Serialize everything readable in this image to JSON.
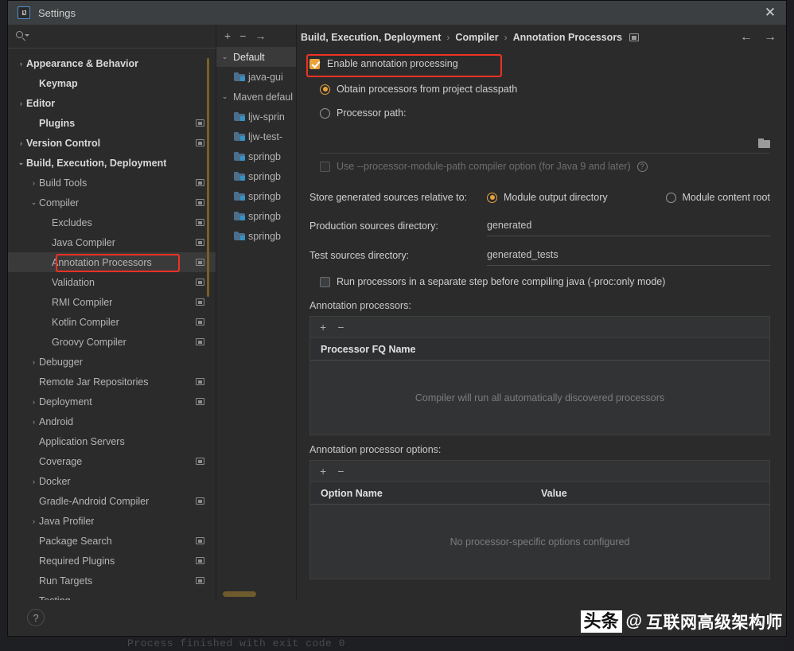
{
  "window": {
    "title": "Settings",
    "logo_text": "IJ",
    "close_label": "✕"
  },
  "search": {
    "value": "",
    "placeholder": ""
  },
  "sidebar": {
    "items": [
      {
        "label": "Appearance & Behavior",
        "chevron": "›",
        "indent": 0,
        "bold": true,
        "badge": false,
        "selected": false
      },
      {
        "label": "Keymap",
        "chevron": "",
        "indent": 1,
        "bold": true,
        "badge": false,
        "selected": false
      },
      {
        "label": "Editor",
        "chevron": "›",
        "indent": 0,
        "bold": true,
        "badge": false,
        "selected": false
      },
      {
        "label": "Plugins",
        "chevron": "",
        "indent": 1,
        "bold": true,
        "badge": true,
        "selected": false
      },
      {
        "label": "Version Control",
        "chevron": "›",
        "indent": 0,
        "bold": true,
        "badge": true,
        "selected": false
      },
      {
        "label": "Build, Execution, Deployment",
        "chevron": "⌄",
        "indent": 0,
        "bold": true,
        "badge": false,
        "selected": false
      },
      {
        "label": "Build Tools",
        "chevron": "›",
        "indent": 1,
        "bold": false,
        "badge": true,
        "selected": false
      },
      {
        "label": "Compiler",
        "chevron": "⌄",
        "indent": 1,
        "bold": false,
        "badge": true,
        "selected": false
      },
      {
        "label": "Excludes",
        "chevron": "",
        "indent": 2,
        "bold": false,
        "badge": true,
        "selected": false
      },
      {
        "label": "Java Compiler",
        "chevron": "",
        "indent": 2,
        "bold": false,
        "badge": true,
        "selected": false
      },
      {
        "label": "Annotation Processors",
        "chevron": "",
        "indent": 2,
        "bold": false,
        "badge": true,
        "selected": true
      },
      {
        "label": "Validation",
        "chevron": "",
        "indent": 2,
        "bold": false,
        "badge": true,
        "selected": false
      },
      {
        "label": "RMI Compiler",
        "chevron": "",
        "indent": 2,
        "bold": false,
        "badge": true,
        "selected": false
      },
      {
        "label": "Kotlin Compiler",
        "chevron": "",
        "indent": 2,
        "bold": false,
        "badge": true,
        "selected": false
      },
      {
        "label": "Groovy Compiler",
        "chevron": "",
        "indent": 2,
        "bold": false,
        "badge": true,
        "selected": false
      },
      {
        "label": "Debugger",
        "chevron": "›",
        "indent": 1,
        "bold": false,
        "badge": false,
        "selected": false
      },
      {
        "label": "Remote Jar Repositories",
        "chevron": "",
        "indent": 1,
        "bold": false,
        "badge": true,
        "selected": false
      },
      {
        "label": "Deployment",
        "chevron": "›",
        "indent": 1,
        "bold": false,
        "badge": true,
        "selected": false
      },
      {
        "label": "Android",
        "chevron": "›",
        "indent": 1,
        "bold": false,
        "badge": false,
        "selected": false
      },
      {
        "label": "Application Servers",
        "chevron": "",
        "indent": 1,
        "bold": false,
        "badge": false,
        "selected": false
      },
      {
        "label": "Coverage",
        "chevron": "",
        "indent": 1,
        "bold": false,
        "badge": true,
        "selected": false
      },
      {
        "label": "Docker",
        "chevron": "›",
        "indent": 1,
        "bold": false,
        "badge": false,
        "selected": false
      },
      {
        "label": "Gradle-Android Compiler",
        "chevron": "",
        "indent": 1,
        "bold": false,
        "badge": true,
        "selected": false
      },
      {
        "label": "Java Profiler",
        "chevron": "›",
        "indent": 1,
        "bold": false,
        "badge": false,
        "selected": false
      },
      {
        "label": "Package Search",
        "chevron": "",
        "indent": 1,
        "bold": false,
        "badge": true,
        "selected": false
      },
      {
        "label": "Required Plugins",
        "chevron": "",
        "indent": 1,
        "bold": false,
        "badge": true,
        "selected": false
      },
      {
        "label": "Run Targets",
        "chevron": "",
        "indent": 1,
        "bold": false,
        "badge": true,
        "selected": false
      },
      {
        "label": "Testing",
        "chevron": "",
        "indent": 1,
        "bold": false,
        "badge": false,
        "selected": false
      }
    ]
  },
  "profiles": {
    "toolbar": {
      "add": "+",
      "remove": "−",
      "move": "→"
    },
    "items": [
      {
        "label": "Default",
        "chevron": "⌄",
        "type": "profile",
        "selected": true
      },
      {
        "label": "java-gui",
        "chevron": "",
        "type": "module",
        "selected": false
      },
      {
        "label": "Maven defaul",
        "chevron": "⌄",
        "type": "profile",
        "selected": false
      },
      {
        "label": "ljw-sprin",
        "chevron": "",
        "type": "module",
        "selected": false
      },
      {
        "label": "ljw-test-",
        "chevron": "",
        "type": "module",
        "selected": false
      },
      {
        "label": "springb",
        "chevron": "",
        "type": "module",
        "selected": false
      },
      {
        "label": "springb",
        "chevron": "",
        "type": "module",
        "selected": false
      },
      {
        "label": "springb",
        "chevron": "",
        "type": "module",
        "selected": false
      },
      {
        "label": "springb",
        "chevron": "",
        "type": "module",
        "selected": false
      },
      {
        "label": "springb",
        "chevron": "",
        "type": "module",
        "selected": false
      }
    ]
  },
  "breadcrumb": {
    "part1": "Build, Execution, Deployment",
    "sep1": "›",
    "part2": "Compiler",
    "sep2": "›",
    "part3": "Annotation Processors",
    "back": "←",
    "forward": "→"
  },
  "main": {
    "enable_annotation_processing": {
      "label": "Enable annotation processing",
      "checked": true,
      "highlighted": true
    },
    "source_mode": {
      "obtain_from_classpath": "Obtain processors from project classpath",
      "processor_path": "Processor path:",
      "selected": "obtain_from_classpath",
      "processor_path_value": ""
    },
    "module_path_option": {
      "label": "Use --processor-module-path compiler option (for Java 9 and later)",
      "checked": false,
      "disabled": true,
      "help": "?"
    },
    "store_sources": {
      "label": "Store generated sources relative to:",
      "option_output": "Module output directory",
      "option_content": "Module content root",
      "selected": "option_output"
    },
    "production_dir": {
      "label": "Production sources directory:",
      "value": "generated"
    },
    "test_dir": {
      "label": "Test sources directory:",
      "value": "generated_tests"
    },
    "proc_only": {
      "label": "Run processors in a separate step before compiling java (-proc:only mode)",
      "checked": false
    },
    "processors_table": {
      "title": "Annotation processors:",
      "add": "+",
      "remove": "−",
      "columns": [
        "Processor FQ Name"
      ],
      "rows": [],
      "empty_text": "Compiler will run all automatically discovered processors"
    },
    "options_table": {
      "title": "Annotation processor options:",
      "add": "+",
      "remove": "−",
      "columns": [
        "Option Name",
        "Value"
      ],
      "rows": [],
      "empty_text": "No processor-specific options configured"
    }
  },
  "footer": {
    "help": "?"
  },
  "watermark": {
    "badge": "头条",
    "at": "@",
    "handle": "互联网高级架构师"
  },
  "background": {
    "console_text": "Process finished with exit code 0"
  },
  "colors": {
    "accent_orange": "#e8a33d",
    "highlight_red": "#ef3124",
    "scrollbar_amber": "#7a6026",
    "dialog_bg": "#2b2b2b",
    "titlebar_bg": "#3c3f41",
    "selected_row": "#3a3a3a"
  }
}
